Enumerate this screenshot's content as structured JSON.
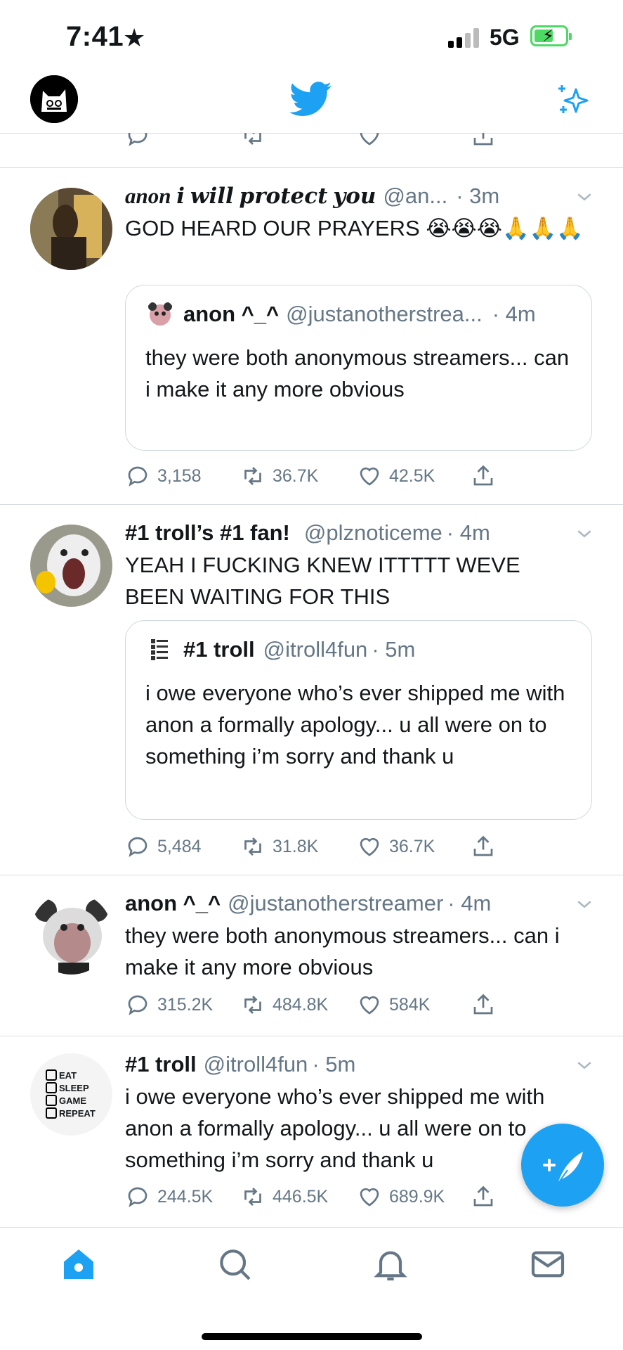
{
  "status_bar": {
    "time": "7:41",
    "network": "5G",
    "battery_color": "#4cd964",
    "icons": [
      "star-icon",
      "signal-icon",
      "battery-charging-icon"
    ]
  },
  "header": {
    "icons": [
      "profile-avatar",
      "twitter-bird-icon",
      "sparkle-icon"
    ],
    "accent": "#1da1f2"
  },
  "tweets": [
    {
      "name": "anon 𝒊 𝒘𝒊𝒍𝒍 𝒑𝒓𝒐𝒕𝒆𝒄𝒕 𝒚𝒐𝒖",
      "handle": "@an...",
      "time": "· 3m",
      "text": "GOD HEARD OUR PRAYERS 😭😭😭🙏🙏🙏",
      "quote": {
        "name": "anon ^_^",
        "handle": "@justanotherstrea...",
        "time": "· 4m",
        "text": "they were both anonymous streamers... can i make it any more obvious"
      },
      "replies": "3,158",
      "retweets": "36.7K",
      "likes": "42.5K"
    },
    {
      "name": "#1 troll’s #1 fan!",
      "handle": "@plznoticeme",
      "time": "· 4m",
      "text": "YEAH I FUCKING KNEW ITTTTT WEVE BEEN WAITING FOR THIS",
      "quote": {
        "name": "#1 troll",
        "handle": "@itroll4fun",
        "time": "· 5m",
        "text": "i owe everyone who’s ever shipped me with anon a formally apology... u all were on to something i’m sorry and thank u"
      },
      "replies": "5,484",
      "retweets": "31.8K",
      "likes": "36.7K"
    },
    {
      "name": "anon ^_^",
      "handle": "@justanotherstreamer",
      "time": "· 4m",
      "text": "they were both anonymous streamers... can i make it any more obvious",
      "replies": "315.2K",
      "retweets": "484.8K",
      "likes": "584K"
    },
    {
      "name": "#1 troll",
      "handle": "@itroll4fun",
      "time": "· 5m",
      "text": "i owe everyone who’s ever shipped me with anon a formally apology... u all were on to something i’m sorry and thank u",
      "avatar_lines": [
        "EAT",
        "SLEEP",
        "GAME",
        "REPEAT"
      ],
      "replies": "244.5K",
      "retweets": "446.5K",
      "likes": "689.9K"
    }
  ],
  "tabbar": {
    "items": [
      "home-icon",
      "search-icon",
      "notifications-icon",
      "messages-icon"
    ],
    "active": "home-icon"
  },
  "fab": {
    "icon": "compose-tweet-icon"
  }
}
